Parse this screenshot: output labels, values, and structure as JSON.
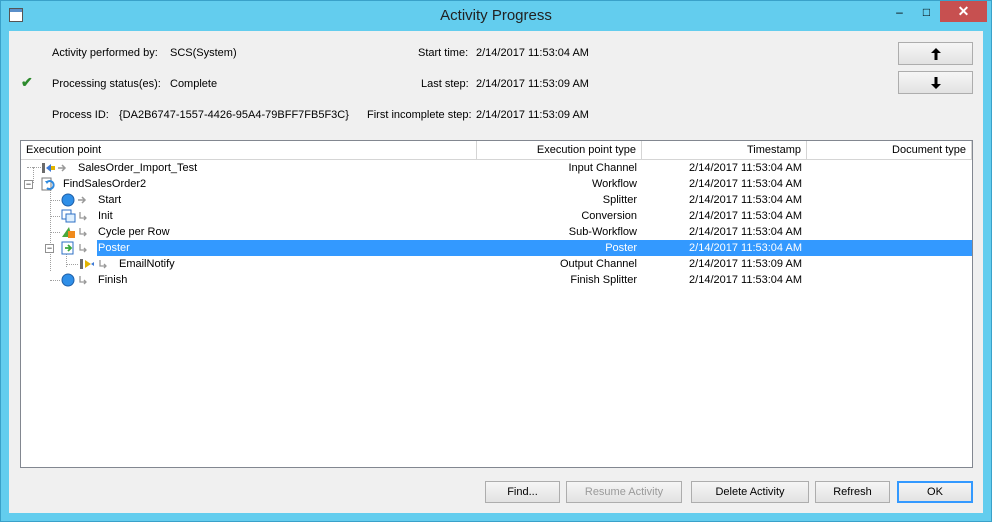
{
  "window": {
    "title": "Activity Progress",
    "min_glyph": "–",
    "max_glyph": "□",
    "close_glyph": "✕"
  },
  "info": {
    "performed_by_label": "Activity performed by:",
    "performed_by_value": "SCS(System)",
    "status_label": "Processing status(es):",
    "status_value": "Complete",
    "process_id_label": "Process ID:",
    "process_id_value": "{DA2B6747-1557-4426-95A4-79BFF7FB5F3C}",
    "start_time_label": "Start time:",
    "start_time_value": "2/14/2017 11:53:04 AM",
    "last_step_label": "Last step:",
    "last_step_value": "2/14/2017 11:53:09 AM",
    "first_incomplete_label": "First incomplete step:",
    "first_incomplete_value": "2/14/2017 11:53:09 AM",
    "status_icon": "checkmark-icon"
  },
  "nav": {
    "up_glyph": "🠅",
    "down_glyph": "🠇"
  },
  "table": {
    "columns": [
      "Execution point",
      "Execution point type",
      "Timestamp",
      "Document type"
    ],
    "rows": [
      {
        "name": "SalesOrder_Import_Test",
        "type": "Input Channel",
        "timestamp": "2/14/2017 11:53:04 AM",
        "doc": "",
        "icon": "input-channel-icon"
      },
      {
        "name": "FindSalesOrder2",
        "type": "Workflow",
        "timestamp": "2/14/2017 11:53:04 AM",
        "doc": "",
        "icon": "workflow-icon"
      },
      {
        "name": "Start",
        "type": "Splitter",
        "timestamp": "2/14/2017 11:53:04 AM",
        "doc": "",
        "icon": "splitter-icon"
      },
      {
        "name": "Init",
        "type": "Conversion",
        "timestamp": "2/14/2017 11:53:04 AM",
        "doc": "",
        "icon": "conversion-icon"
      },
      {
        "name": "Cycle per Row",
        "type": "Sub-Workflow",
        "timestamp": "2/14/2017 11:53:04 AM",
        "doc": "",
        "icon": "sub-workflow-icon"
      },
      {
        "name": "Poster",
        "type": "Poster",
        "timestamp": "2/14/2017 11:53:04 AM",
        "doc": "",
        "icon": "poster-icon"
      },
      {
        "name": "EmailNotify",
        "type": "Output Channel",
        "timestamp": "2/14/2017 11:53:09 AM",
        "doc": "",
        "icon": "output-channel-icon"
      },
      {
        "name": "Finish",
        "type": "Finish Splitter",
        "timestamp": "2/14/2017 11:53:04 AM",
        "doc": "",
        "icon": "finish-splitter-icon"
      }
    ],
    "selected_row": "Poster"
  },
  "buttons": {
    "find": "Find...",
    "resume": "Resume Activity",
    "delete": "Delete Activity",
    "refresh": "Refresh",
    "ok": "OK"
  },
  "colors": {
    "titlebar": "#63cdee",
    "selection": "#3399ff",
    "close": "#c75050"
  }
}
